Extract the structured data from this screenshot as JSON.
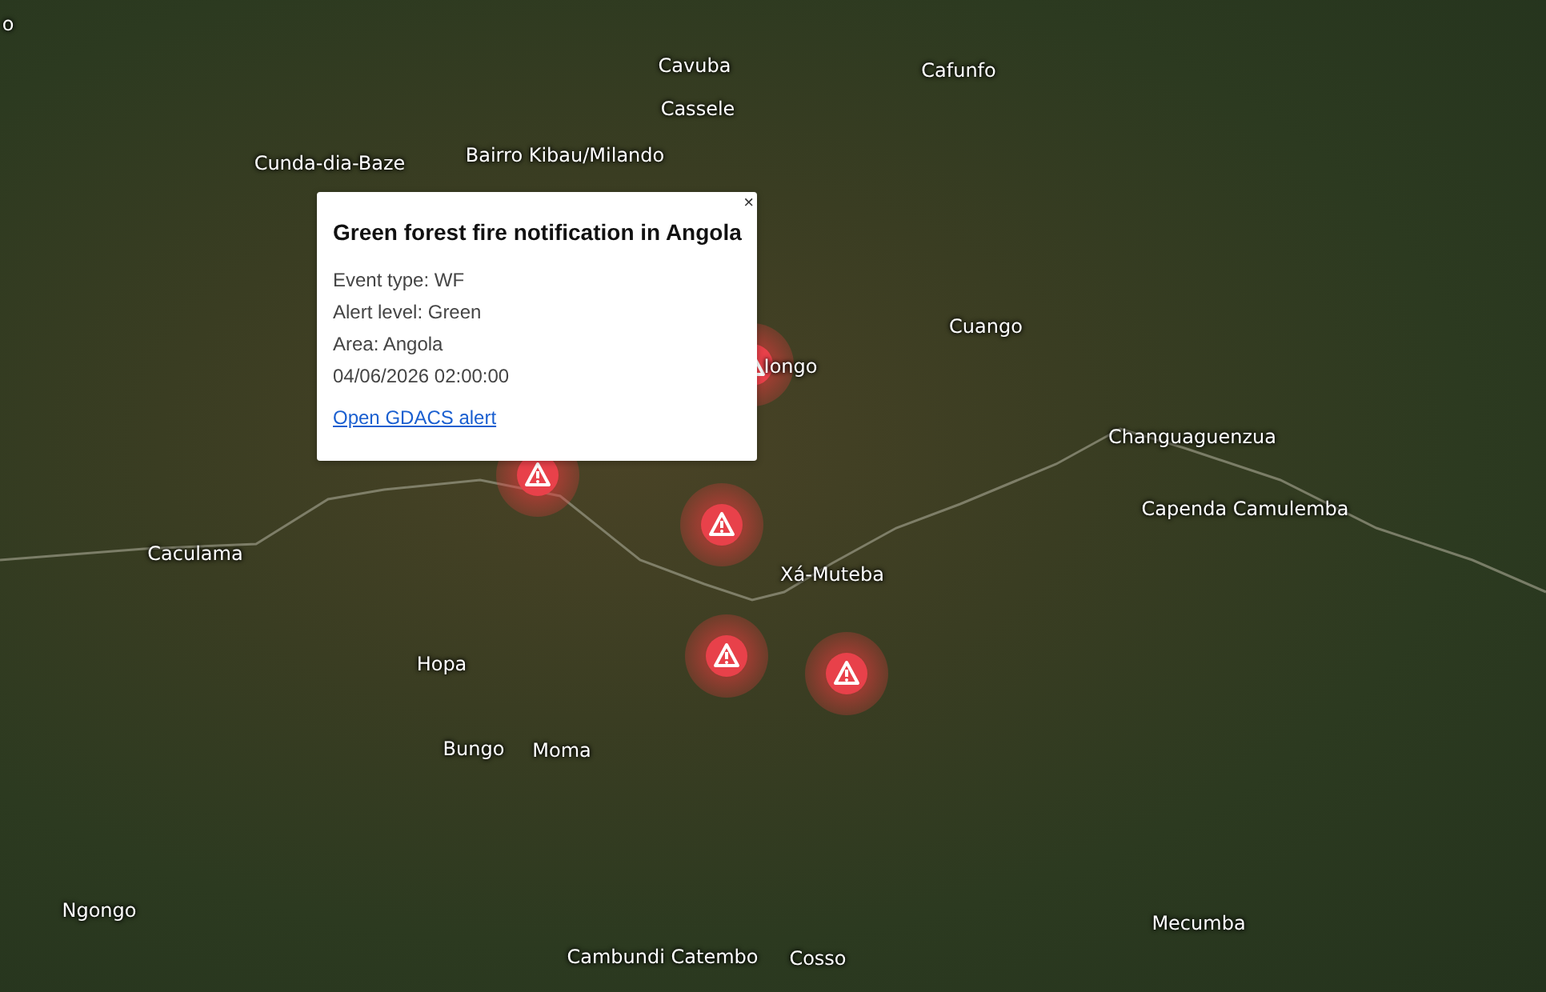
{
  "map": {
    "labels": [
      {
        "text": "o"
      },
      {
        "text": "Cavuba"
      },
      {
        "text": "Cafunfo"
      },
      {
        "text": "Cassele"
      },
      {
        "text": "Cunda-dia-Baze"
      },
      {
        "text": "Bairro Kibau/Milando"
      },
      {
        "text": "Iongo"
      },
      {
        "text": "Cuango"
      },
      {
        "text": "Changuaguenzua"
      },
      {
        "text": "Capenda Camulemba"
      },
      {
        "text": "Caculama"
      },
      {
        "text": "Xá-Muteba"
      },
      {
        "text": "Hopa"
      },
      {
        "text": "Bungo"
      },
      {
        "text": "Moma"
      },
      {
        "text": "Ngongo"
      },
      {
        "text": "Mecumba"
      },
      {
        "text": "Cambundi Catembo"
      },
      {
        "text": "Cosso"
      }
    ],
    "markers": [
      {
        "kind": "alert"
      },
      {
        "kind": "alert"
      },
      {
        "kind": "alert"
      },
      {
        "kind": "alert"
      },
      {
        "kind": "alert"
      }
    ]
  },
  "popup": {
    "title": "Green forest fire notification in Angola",
    "close": "×",
    "lines": [
      "Event type: WF",
      "Alert level: Green",
      "Area: Angola",
      "04/06/2026 02:00:00"
    ],
    "link": "Open GDACS alert"
  }
}
